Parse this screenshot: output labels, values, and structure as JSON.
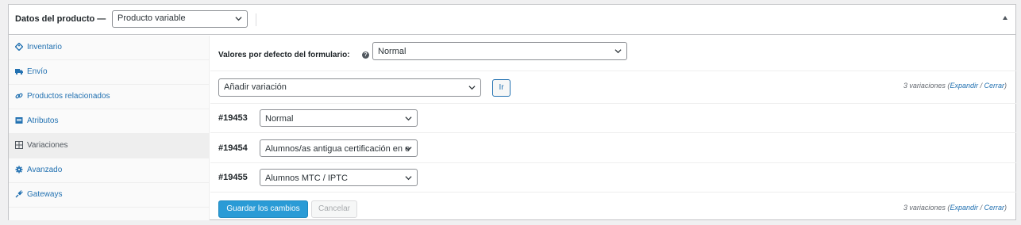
{
  "header": {
    "title": "Datos del producto",
    "dash": "—",
    "product_type": "Producto variable"
  },
  "sidebar": {
    "items": [
      {
        "label": "Inventario",
        "icon": "tag-icon"
      },
      {
        "label": "Envío",
        "icon": "truck-icon"
      },
      {
        "label": "Productos relacionados",
        "icon": "link-icon"
      },
      {
        "label": "Atributos",
        "icon": "list-icon"
      },
      {
        "label": "Variaciones",
        "icon": "grid-icon"
      },
      {
        "label": "Avanzado",
        "icon": "gear-icon"
      },
      {
        "label": "Gateways",
        "icon": "plug-icon"
      }
    ],
    "active_index": 4
  },
  "defaults": {
    "label": "Valores por defecto del formulario:",
    "help": "?",
    "value": "Normal"
  },
  "add_variation": {
    "select_value": "Añadir variación",
    "go_label": "Ir"
  },
  "summary_top": {
    "count_text": "3 variaciones (",
    "expand": "Expandir",
    "sep": " / ",
    "close": "Cerrar",
    "end": ")"
  },
  "variations": [
    {
      "id": "#19453",
      "value": "Normal"
    },
    {
      "id": "#19454",
      "value": "Alumnos/as antigua certificación en e"
    },
    {
      "id": "#19455",
      "value": "Alumnos MTC / IPTC"
    }
  ],
  "footer": {
    "save_label": "Guardar los cambios",
    "cancel_label": "Cancelar",
    "count_text": "3 variaciones (",
    "expand": "Expandir",
    "sep": " / ",
    "close": "Cerrar",
    "end": ")"
  },
  "colors": {
    "link": "#2271b1",
    "primary_button": "#2a9bd6",
    "active_tab_bg": "#eeeeee"
  }
}
